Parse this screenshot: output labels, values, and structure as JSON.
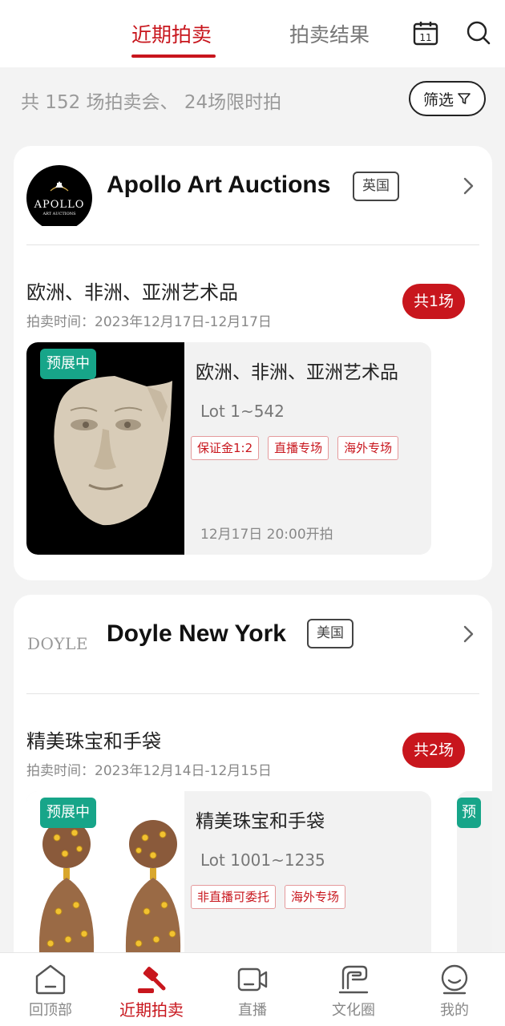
{
  "tabs": [
    {
      "label": "近期拍卖",
      "active": true
    },
    {
      "label": "拍卖结果",
      "active": false
    }
  ],
  "header": {
    "calendar_day": "11",
    "icons": [
      "calendar-icon",
      "search-icon"
    ]
  },
  "summary": {
    "text": "共 152 场拍卖会、 24场限时拍",
    "filter_label": "筛选"
  },
  "auction_houses": [
    {
      "name": "Apollo Art Auctions",
      "country": "英国",
      "logo_text": "APOLLO",
      "logo_subtext": "ART AUCTIONS",
      "sale_title": "欧洲、非洲、亚洲艺术品",
      "sale_time": "拍卖时间：2023年12月17日-12月17日",
      "count_badge": "共1场",
      "session": {
        "status": "预展中",
        "title": "欧洲、非洲、亚洲艺术品",
        "lot": "Lot 1~542",
        "tags": [
          "保证金1:2",
          "直播专场",
          "海外专场"
        ],
        "start": "12月17日 20:00开拍"
      }
    },
    {
      "name": "Doyle New York",
      "country": "美国",
      "logo_text": "DOYLE",
      "sale_title": "精美珠宝和手袋",
      "sale_time": "拍卖时间：2023年12月14日-12月15日",
      "count_badge": "共2场",
      "session": {
        "status": "预展中",
        "title": "精美珠宝和手袋",
        "lot": "Lot 1001~1235",
        "tags": [
          "非直播可委托",
          "海外专场"
        ]
      },
      "next_session_status": "预"
    }
  ],
  "bottom_nav": [
    {
      "label": "回顶部",
      "icon": "back-to-top-icon",
      "active": false
    },
    {
      "label": "近期拍卖",
      "icon": "gavel-icon",
      "active": true
    },
    {
      "label": "直播",
      "icon": "video-camera-icon",
      "active": false
    },
    {
      "label": "文化圈",
      "icon": "culture-circle-icon",
      "active": false
    },
    {
      "label": "我的",
      "icon": "profile-icon",
      "active": false
    }
  ],
  "colors": {
    "accent": "#c8161d",
    "badge_green": "#17a589",
    "background": "#f3f3f3"
  }
}
